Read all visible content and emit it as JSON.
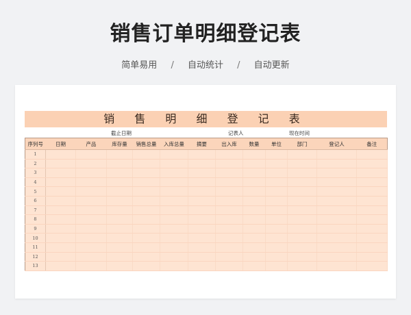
{
  "header": {
    "title": "销售订单明细登记表",
    "subtitles": [
      "简单易用",
      "自动统计",
      "自动更新"
    ],
    "separator": "/"
  },
  "sheet": {
    "title": "销 售 明 细 登 记 表",
    "meta": {
      "cutoff_label": "截止日期",
      "recorder_label": "记表人",
      "current_time_label": "现在时间"
    },
    "columns": [
      "序列号",
      "日期",
      "产品",
      "库存量",
      "销售总量",
      "入库总量",
      "摘要",
      "出入库",
      "数量",
      "单位",
      "部门",
      "登记人",
      "备注"
    ],
    "rows": [
      "1",
      "2",
      "3",
      "4",
      "5",
      "6",
      "7",
      "8",
      "9",
      "10",
      "11",
      "12",
      "13"
    ]
  },
  "colors": {
    "title_band": "#fbd1b4",
    "header_fill": "#fbd5bb",
    "row_fill": "#fee4d2",
    "border": "#b99a86"
  }
}
